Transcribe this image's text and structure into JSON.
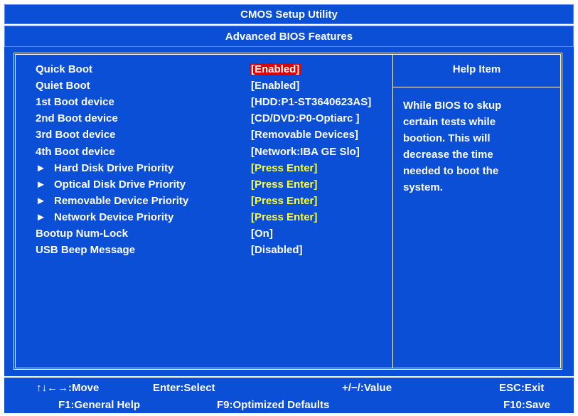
{
  "title": "CMOS Setup Utility",
  "subtitle": "Advanced BIOS Features",
  "help": {
    "title": "Help Item",
    "text": "While BIOS to skup\ncertain tests while\nbootion. This will\ndecrease the time\nneeded to boot the\nsystem."
  },
  "items": [
    {
      "label": "Quick Boot",
      "value": "[Enabled]",
      "submenu": false,
      "selected": true
    },
    {
      "label": "Quiet Boot",
      "value": "[Enabled]",
      "submenu": false,
      "selected": false
    },
    {
      "label": "1st Boot device",
      "value": "[HDD:P1-ST3640623AS]",
      "submenu": false,
      "selected": false
    },
    {
      "label": "2nd Boot device",
      "value": "[CD/DVD:P0-Optiarc ]",
      "submenu": false,
      "selected": false
    },
    {
      "label": "3rd Boot device",
      "value": "[Removable Devices]",
      "submenu": false,
      "selected": false
    },
    {
      "label": "4th Boot device",
      "value": "[Network:IBA GE Slo]",
      "submenu": false,
      "selected": false
    },
    {
      "label": "Hard Disk Drive Priority",
      "value": "[Press Enter]",
      "submenu": true,
      "selected": false
    },
    {
      "label": "Optical Disk Drive Priority",
      "value": "[Press Enter]",
      "submenu": true,
      "selected": false
    },
    {
      "label": "Removable Device Priority",
      "value": "[Press Enter]",
      "submenu": true,
      "selected": false
    },
    {
      "label": "Network Device Priority",
      "value": "[Press Enter]",
      "submenu": true,
      "selected": false
    },
    {
      "label": "Bootup Num-Lock",
      "value": "[On]",
      "submenu": false,
      "selected": false
    },
    {
      "label": "USB Beep Message",
      "value": "[Disabled]",
      "submenu": false,
      "selected": false
    }
  ],
  "footer": {
    "move": "↑↓←→:Move",
    "select": "Enter:Select",
    "value": "+/−/:Value",
    "exit": "ESC:Exit",
    "general_help": "F1:General Help",
    "optimized": "F9:Optimized Defaults",
    "save": "F10:Save"
  },
  "colors": {
    "panel": "#0a4fd6",
    "selected_bg": "#e00000",
    "submenu_text": "#ffff33",
    "text": "#ffffff"
  },
  "submenu_arrow": "►"
}
